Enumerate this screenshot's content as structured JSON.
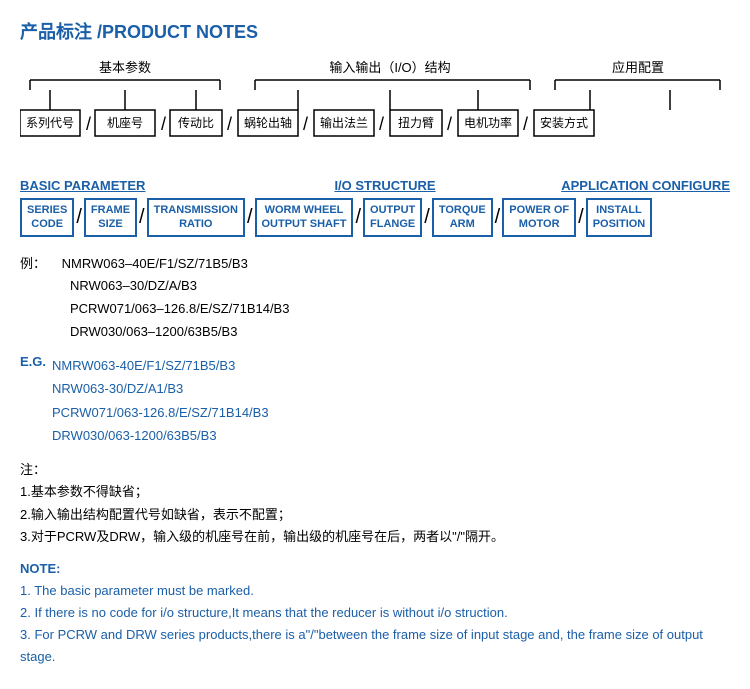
{
  "title": {
    "cn": "产品标注",
    "en": "/PRODUCT NOTES"
  },
  "cn_diagram": {
    "groups": [
      {
        "label": "基本参数",
        "offset": "left"
      },
      {
        "label": "输入输出（I/O）结构",
        "offset": "center"
      },
      {
        "label": "应用配置",
        "offset": "right"
      }
    ],
    "boxes": [
      "系列代号",
      "机座号",
      "传动比",
      "蜗轮出轴",
      "输出法兰",
      "扭力臂",
      "电机功率",
      "安装方式"
    ]
  },
  "en_diagram": {
    "section_labels": {
      "basic": "BASIC PARAMETER",
      "io": "I/O STRUCTURE",
      "app": "APPLICATION CONFIGURE"
    },
    "boxes": [
      {
        "line1": "SERIES",
        "line2": "CODE"
      },
      {
        "line1": "FRAME",
        "line2": "SIZE"
      },
      {
        "line1": "TRANSMISSION",
        "line2": "RATIO"
      },
      {
        "line1": "WORM WHEEL",
        "line2": "OUTPUT SHAFT"
      },
      {
        "line1": "OUTPUT",
        "line2": "FLANGE"
      },
      {
        "line1": "TORQUE",
        "line2": "ARM"
      },
      {
        "line1": "POWER OF",
        "line2": "MOTOR"
      },
      {
        "line1": "INSTALL",
        "line2": "POSITION"
      }
    ]
  },
  "examples": {
    "label": "例：",
    "items": [
      "NMRW063–40E/F1/SZ/71B5/B3",
      "NRW063–30/DZ/A/B3",
      "PCRW071/063–126.8/E/SZ/71B14/B3",
      "DRW030/063–1200/63B5/B3"
    ]
  },
  "examples_en": {
    "label": "E.G.",
    "items": [
      "NMRW063-40E/F1/SZ/71B5/B3",
      "NRW063-30/DZ/A1/B3",
      "PCRW071/063-126.8/E/SZ/71B14/B3",
      "DRW030/063-1200/63B5/B3"
    ]
  },
  "notes_cn": {
    "title": "注：",
    "items": [
      "1.基本参数不得缺省；",
      "2.输入输出结构配置代号如缺省，表示不配置；",
      "3.对于PCRW及DRW，输入级的机座号在前，输出级的机座号在后，两者以\"/\"隔开。"
    ]
  },
  "notes_en": {
    "title": "NOTE:",
    "items": [
      "1. The basic parameter must be marked.",
      "2. If there is no code for i/o structure,It  means that the reducer is without i/o struction.",
      "3. For PCRW and DRW series products,there is a\"/\"between the frame size of input stage and,  the frame size of output stage."
    ]
  }
}
